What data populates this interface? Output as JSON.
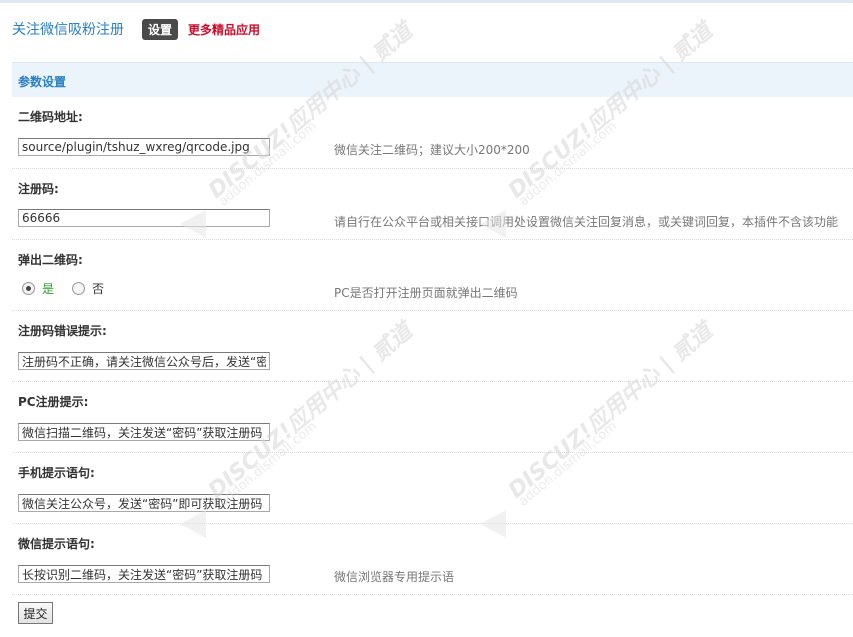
{
  "header": {
    "app_title": "关注微信吸粉注册",
    "tab_settings": "设置",
    "more_apps": "更多精品应用"
  },
  "section": {
    "title": "参数设置"
  },
  "fields": [
    {
      "label": "二维码地址:",
      "value": "source/plugin/tshuz_wxreg/qrcode.jpg",
      "hint": "微信关注二维码；建议大小200*200"
    },
    {
      "label": "注册码:",
      "value": "66666",
      "hint": "请自行在公众平台或相关接口调用处设置微信关注回复消息，或关键词回复，本插件不含该功能"
    },
    {
      "label": "弹出二维码:",
      "hint": "PC是否打开注册页面就弹出二维码",
      "options": [
        "是",
        "否"
      ],
      "selected": "是"
    },
    {
      "label": "注册码错误提示:",
      "value": "注册码不正确，请关注微信公众号后，发送“密码”",
      "hint": ""
    },
    {
      "label": "PC注册提示:",
      "value": "微信扫描二维码，关注发送“密码”获取注册码",
      "hint": ""
    },
    {
      "label": "手机提示语句:",
      "value": "微信关注公众号，发送“密码”即可获取注册码",
      "hint": ""
    },
    {
      "label": "微信提示语句:",
      "value": "长按识别二维码，关注发送“密码”获取注册码",
      "hint": "微信浏览器专用提示语"
    }
  ],
  "submit_label": "提交",
  "watermark": {
    "brand": "DISCUZ!应用中心 | 贰道",
    "site": "addon.dismall.com"
  },
  "colors": {
    "accent": "#2a7fc1",
    "link_red": "#c8102e",
    "section_bg": "#ebf4fb",
    "yes_green": "#2e9b2e"
  }
}
